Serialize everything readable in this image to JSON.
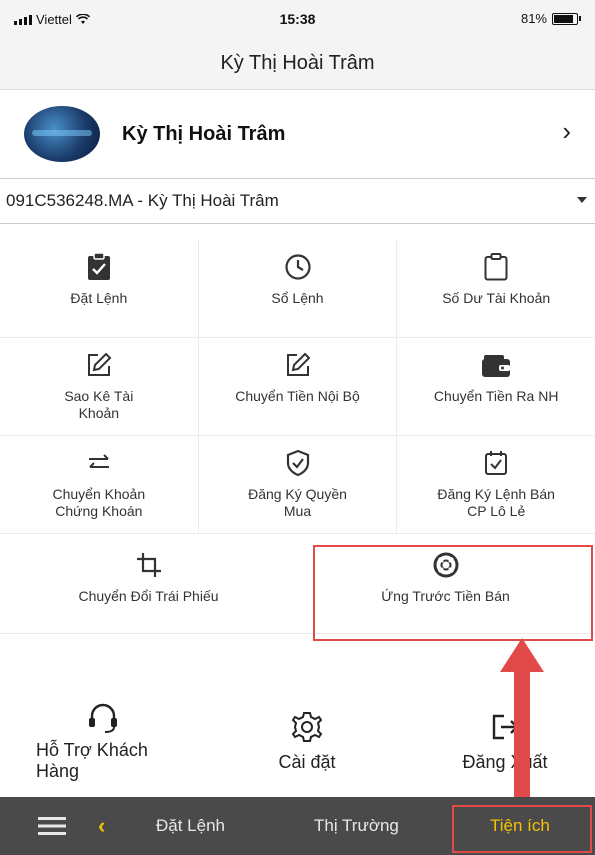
{
  "status_bar": {
    "carrier": "Viettel",
    "time": "15:38",
    "battery_percent": "81%",
    "battery_level": 0.81
  },
  "header": {
    "title": "Kỳ Thị Hoài Trâm"
  },
  "profile": {
    "name": "Kỳ Thị Hoài Trâm"
  },
  "account_select": {
    "value": "091C536248.MA - Kỳ Thị Hoài Trâm"
  },
  "grid": {
    "row1": [
      {
        "label": "Đặt Lệnh",
        "icon": "clipboard-check-icon"
      },
      {
        "label": "Sổ Lệnh",
        "icon": "clock-icon"
      },
      {
        "label": "Số Dư Tài Khoản",
        "icon": "clipboard-icon"
      }
    ],
    "row2": [
      {
        "label": "Sao Kê Tài Khoản",
        "icon": "edit-icon"
      },
      {
        "label": "Chuyển Tiền Nội Bộ",
        "icon": "edit-icon"
      },
      {
        "label": "Chuyển Tiền Ra NH",
        "icon": "wallet-icon"
      }
    ],
    "row3": [
      {
        "label": "Chuyển Khoản Chứng Khoán",
        "icon": "swap-arrows-icon"
      },
      {
        "label": "Đăng Ký Quyền Mua",
        "icon": "shield-check-icon"
      },
      {
        "label": "Đăng Ký Lệnh Bán CP Lô Lẻ",
        "icon": "calendar-check-icon"
      }
    ],
    "row4": [
      {
        "label": "Chuyển Đổi Trái Phiếu",
        "icon": "crop-icon"
      },
      {
        "label": "Ứng Trước Tiền Bán",
        "icon": "lifebuoy-icon"
      }
    ]
  },
  "actions": [
    {
      "label": "Hỗ Trợ Khách Hàng",
      "icon": "headset-icon"
    },
    {
      "label": "Cài đặt",
      "icon": "gear-icon"
    },
    {
      "label": "Đăng Xuất",
      "icon": "logout-icon"
    }
  ],
  "tabbar": {
    "tabs": [
      "Đặt Lệnh",
      "Thị Trường",
      "Tiện ích"
    ],
    "active": "Tiện ích"
  },
  "colors": {
    "highlight": "#e24a4a",
    "tabbar_bg": "#4a4a4a",
    "tab_active": "#f5c200"
  }
}
